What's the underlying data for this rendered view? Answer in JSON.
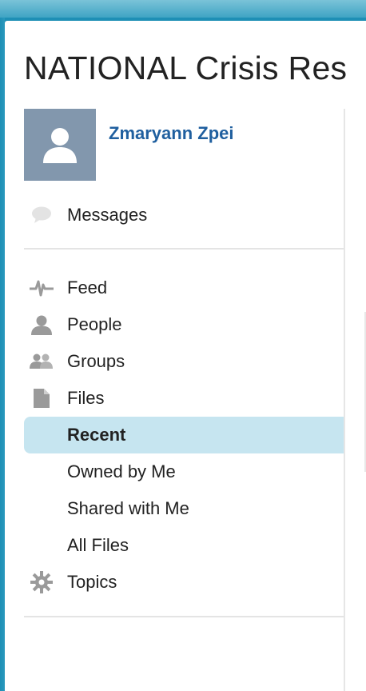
{
  "page": {
    "title": "NATIONAL Crisis Res"
  },
  "user": {
    "name": "Zmaryann Zpei",
    "avatar_icon": "user-silhouette-icon"
  },
  "nav": {
    "messages": {
      "label": "Messages",
      "icon": "speech-bubble-icon"
    },
    "feed": {
      "label": "Feed",
      "icon": "pulse-icon"
    },
    "people": {
      "label": "People",
      "icon": "person-icon"
    },
    "groups": {
      "label": "Groups",
      "icon": "group-icon"
    },
    "files": {
      "label": "Files",
      "icon": "document-icon"
    },
    "recent": {
      "label": "Recent",
      "selected": true
    },
    "owned_by_me": {
      "label": "Owned by Me"
    },
    "shared_with_me": {
      "label": "Shared with Me"
    },
    "all_files": {
      "label": "All Files"
    },
    "topics": {
      "label": "Topics",
      "icon": "gear-icon"
    }
  },
  "colors": {
    "header_blue": "#1e8fb5",
    "selected_bg": "#c6e5f0",
    "link_blue": "#1f5f9f",
    "avatar_bg": "#8297ad",
    "icon_gray": "#9a9a9a"
  }
}
